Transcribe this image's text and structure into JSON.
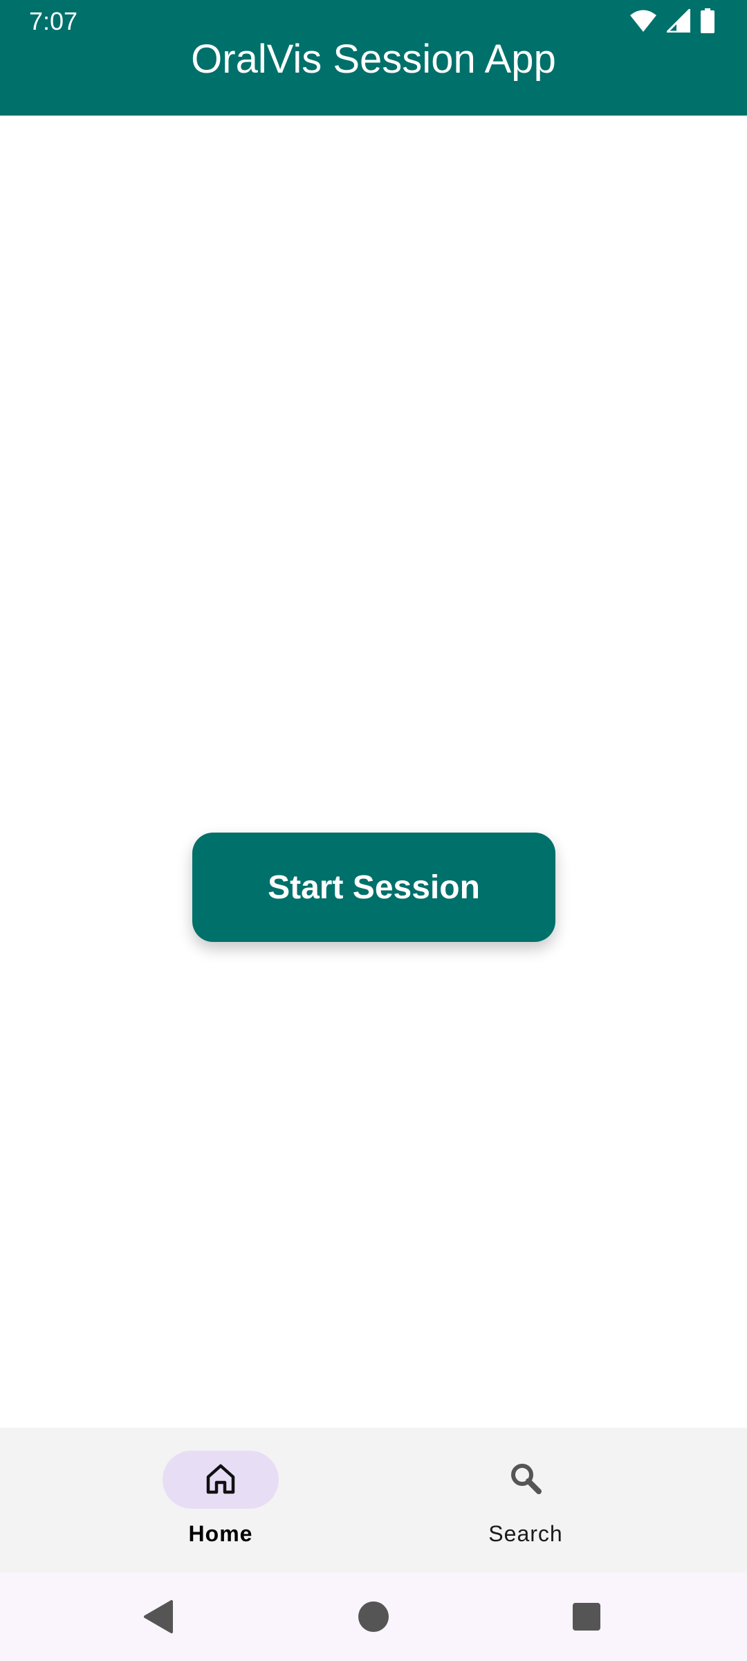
{
  "status_bar": {
    "time": "7:07",
    "icons": [
      "wifi-icon",
      "cell-signal-icon",
      "battery-icon"
    ]
  },
  "app_bar": {
    "title": "OralVis Session App"
  },
  "main": {
    "start_button_label": "Start Session"
  },
  "bottom_nav": {
    "items": [
      {
        "label": "Home",
        "icon": "home-icon",
        "selected": true
      },
      {
        "label": "Search",
        "icon": "search-icon",
        "selected": false
      }
    ]
  },
  "system_nav": {
    "buttons": [
      "back-icon",
      "home-circle-icon",
      "recents-icon"
    ]
  },
  "colors": {
    "primary": "#00706B",
    "nav_background": "#F3F3F3",
    "nav_indicator": "#E7DEF6",
    "system_nav_background": "#FAF5FC"
  }
}
